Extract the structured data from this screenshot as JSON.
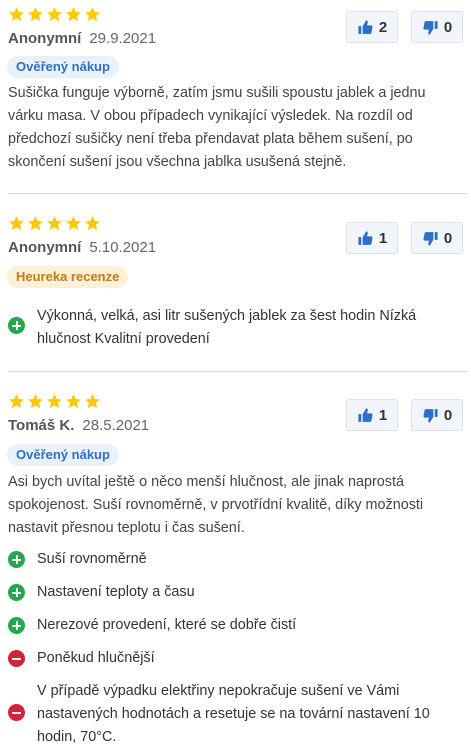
{
  "colors": {
    "star": "#ffc800",
    "accent_blue": "#2f6fc4",
    "pro_green": "#22a94a",
    "con_red": "#d3223a"
  },
  "reviews": [
    {
      "rating": 5,
      "author": "Anonymní",
      "date": "29.9.2021",
      "badge": "Ověřený nákup",
      "likes": "2",
      "dislikes": "0",
      "text": "Sušička funguje výborně, zatím jsmu sušili spoustu jablek a jednu várku masa. V obou případech vynikající výsledek. Na rozdíl od předchozí sušičky není třeba přendavat plata během sušení, po skončení sušení jsou všechna jablka usušená stejně."
    },
    {
      "rating": 5,
      "author": "Anonymní",
      "date": "5.10.2021",
      "badge": "Heureka recenze",
      "likes": "1",
      "dislikes": "0",
      "pros": [
        "Výkonná, velká, asi litr sušených jablek za šest hodin Nízká hlučnost Kvalitní provedení"
      ]
    },
    {
      "rating": 5,
      "author": "Tomáš K.",
      "date": "28.5.2021",
      "badge": "Ověřený nákup",
      "likes": "1",
      "dislikes": "0",
      "text": "Asi bych uvítal ještě o něco menší hlučnost, ale jinak naprostá spokojenost. Suší rovnoměrně, v prvotřídní kvalitě, díky možnosti nastavit přesnou teplotu i čas sušení.",
      "pros": [
        "Suší rovnoměrně",
        "Nastavení teploty a času",
        "Nerezové provedení, které se dobře čistí"
      ],
      "cons": [
        "Poněkud hlučnější",
        "V případě výpadku elektřiny nepokračuje sušení ve Vámi nastavených hodnotách a resetuje se na tovární nastavení 10 hodin, 70°C."
      ]
    }
  ]
}
